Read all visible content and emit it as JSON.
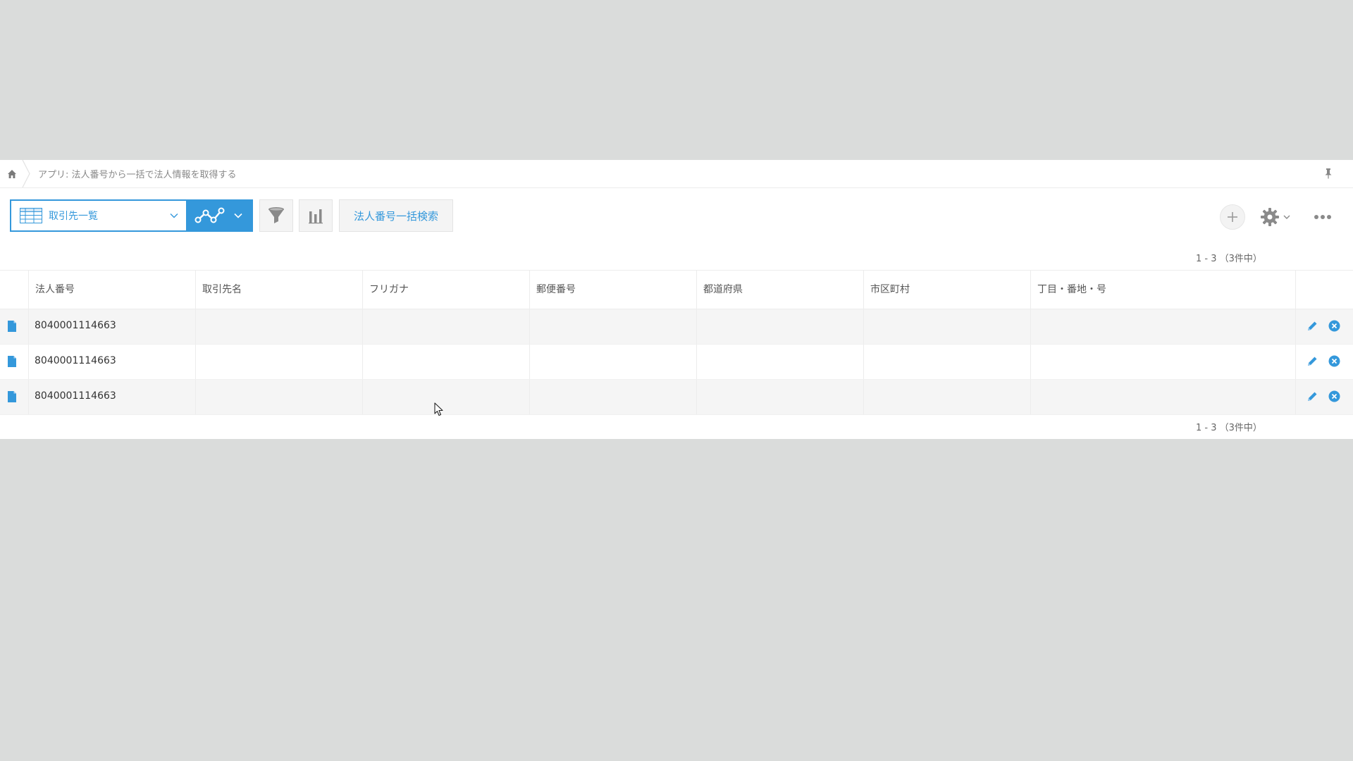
{
  "breadcrumb": {
    "text": "アプリ: 法人番号から一括で法人情報を取得する"
  },
  "toolbar": {
    "view_label": "取引先一覧",
    "bulk_search_label": "法人番号一括検索"
  },
  "pagination": {
    "top": "1 - 3 （3件中）",
    "bottom": "1 - 3 （3件中）"
  },
  "table": {
    "columns": [
      "法人番号",
      "取引先名",
      "フリガナ",
      "郵便番号",
      "都道府県",
      "市区町村",
      "丁目・番地・号"
    ],
    "rows": [
      {
        "corp_number": "8040001114663"
      },
      {
        "corp_number": "8040001114663"
      },
      {
        "corp_number": "8040001114663"
      }
    ]
  },
  "colors": {
    "accent": "#3498db",
    "background": "#dadcdb",
    "panel": "#ffffff",
    "row_stripe": "#f5f5f5"
  },
  "icons": {
    "home": "home-icon",
    "pin": "pin-icon",
    "view": "table-view-icon",
    "graph": "graph-icon",
    "filter": "filter-icon",
    "chart": "bar-chart-icon",
    "add": "plus-icon",
    "settings": "gear-icon",
    "more": "more-icon",
    "record": "document-icon",
    "edit": "pencil-icon",
    "delete": "delete-icon"
  }
}
